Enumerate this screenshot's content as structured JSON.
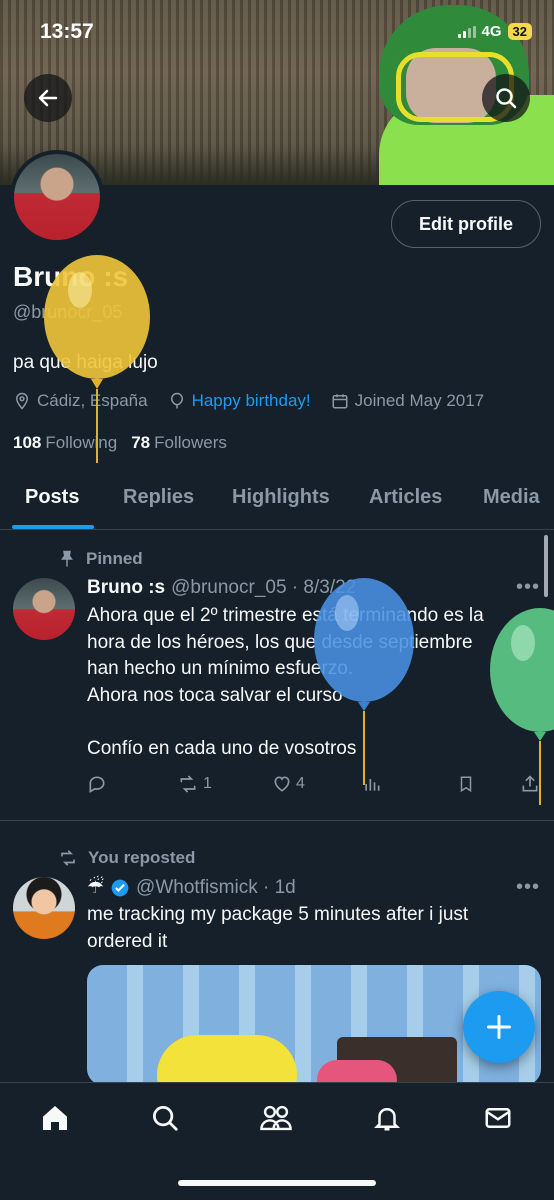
{
  "status_bar": {
    "time": "13:57",
    "network": "4G",
    "battery": "32"
  },
  "profile": {
    "name": "Bruno :s",
    "handle": "@brunocr_05",
    "bio": "pa que haiga lujo",
    "location": "Cádiz, España",
    "birthday": "Happy birthday!",
    "joined": "Joined May 2017",
    "following_count": "108",
    "following_label": "Following",
    "followers_count": "78",
    "followers_label": "Followers",
    "edit_button": "Edit profile"
  },
  "tabs": [
    "Posts",
    "Replies",
    "Highlights",
    "Articles",
    "Media"
  ],
  "posts": [
    {
      "context": "Pinned",
      "name": "Bruno :s",
      "meta": "@brunocr_05 · 8/3/22",
      "text": [
        "Ahora que el 2º trimestre está terminando es la",
        "hora de los héroes, los que desde septiembre",
        "han hecho un mínimo esfuerzo.",
        "Ahora nos toca salvar el curso",
        "",
        "Confío en cada uno de vosotros"
      ],
      "retweets": "1",
      "likes": "4"
    },
    {
      "context": "You reposted",
      "name": "☔",
      "meta": "@Whotfismick · 1d",
      "text": [
        "me tracking my package 5 minutes after i just",
        "ordered it"
      ]
    }
  ],
  "icons": [
    "back-arrow-icon",
    "search-icon",
    "location-icon",
    "balloon-icon",
    "calendar-icon",
    "pin-icon",
    "repost-icon",
    "reply-icon",
    "like-icon",
    "views-icon",
    "bookmark-icon",
    "share-icon",
    "verified-icon",
    "plus-icon",
    "home-icon",
    "communities-icon",
    "bell-icon",
    "mail-icon"
  ],
  "colors": {
    "background": "#15202b",
    "accent": "#1d9bf0",
    "muted": "#8b98a5",
    "balloon_yellow": "#f0c53a",
    "balloon_blue": "#4a90e2",
    "balloon_green": "#5fd08a"
  }
}
